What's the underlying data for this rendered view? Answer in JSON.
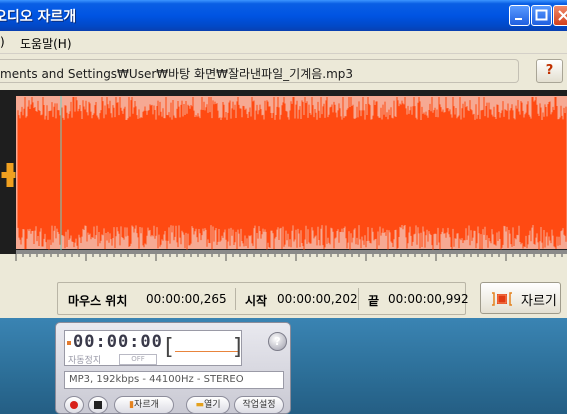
{
  "window": {
    "title": "오디오 자르개",
    "menu": [
      {
        "label": ")"
      },
      {
        "label": "도움말(H)"
      }
    ],
    "file_path": "ments and Settings₩User₩바탕 화면₩잘라낸파일_기계음.mp3",
    "help_label": "?"
  },
  "waveform": {
    "colors": {
      "background": "#1e1e1e",
      "selection": "#f6a993",
      "wave": "#ff4a12",
      "cursor": "#6fd0c4"
    }
  },
  "status": {
    "mouse_label": "마우스 위치",
    "mouse_value": "00:00:00,265",
    "start_label": "시작",
    "start_value": "00:00:00,202",
    "end_label": "끝",
    "end_value": "00:00:00,992",
    "cut_button": "자르기"
  },
  "player": {
    "time": "00:00:00",
    "auto_label": "자동정지",
    "off_label": "OFF",
    "info": "MP3, 192kbps - 44100Hz - STEREO",
    "help_label": "?",
    "buttons": {
      "cut": "자르개",
      "open": "열기",
      "settings": "작업설정"
    }
  }
}
